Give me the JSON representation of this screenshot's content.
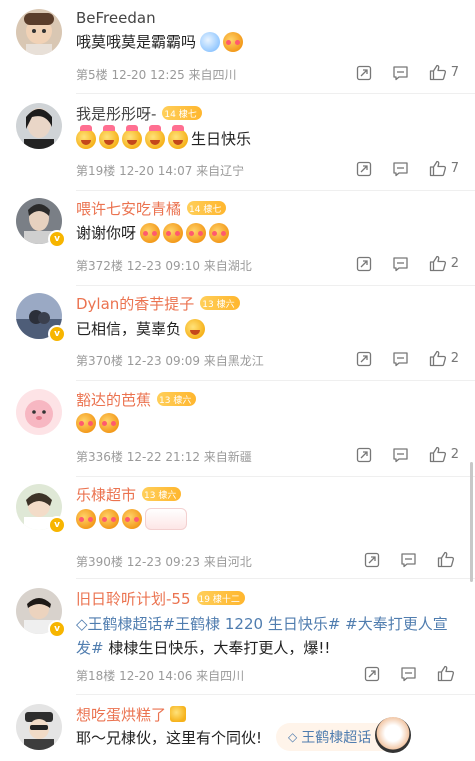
{
  "comments": [
    {
      "username": "BeFreedan",
      "badge": "",
      "text": "哦莫哦莫是霸霸吗",
      "meta": "第5楼 12-20 12:25 来自四川",
      "likes": "7"
    },
    {
      "username": "我是彤彤呀-",
      "badge": "14 棣七",
      "text": "生日快乐",
      "meta": "第19楼 12-20 14:07 来自辽宁",
      "likes": "7"
    },
    {
      "username": "喂许七安吃青橘",
      "badge": "14 棣七",
      "text": "谢谢你呀",
      "meta": "第372楼 12-23 09:10 来自湖北",
      "likes": "2"
    },
    {
      "username": "Dylan的香芋提子",
      "badge": "13 棣六",
      "text": "已相信，莫辜负",
      "meta": "第370楼 12-23 09:09 来自黑龙江",
      "likes": "2"
    },
    {
      "username": "豁达的芭蕉",
      "badge": "13 棣六",
      "text": "",
      "meta": "第336楼 12-22 21:12 来自新疆",
      "likes": "2"
    },
    {
      "username": "乐棣超市",
      "badge": "13 棣六",
      "text": "",
      "meta": "第390楼 12-23 09:23 来自河北",
      "likes": ""
    },
    {
      "username": "旧日聆听计划-55",
      "badge": "19 棣十二",
      "text_topic": "王鹤棣超话#王鹤棣 1220 生日快乐# #大奉打更人宣发#",
      "text": "棣棣生日快乐，大奉打更人，爆!!",
      "meta": "第18楼 12-20 14:06 来自四川",
      "likes": ""
    },
    {
      "username": "想吃蛋烘糕了",
      "badge": "",
      "text": "耶～兄棣伙，这里有个同伙!",
      "meta": "",
      "likes": ""
    }
  ],
  "floating_topic": "王鹤棣超话",
  "icons": {
    "share": "share-icon",
    "comment": "comment-icon",
    "like": "thumbs-up-icon",
    "verified": "verified-icon",
    "diamond": "diamond-icon"
  },
  "colors": {
    "vip_name": "#eb7350",
    "normal_name": "#444444",
    "topic_link": "#507daf",
    "badge_gold": "#ffb62e",
    "meta": "#9a9a9a"
  }
}
